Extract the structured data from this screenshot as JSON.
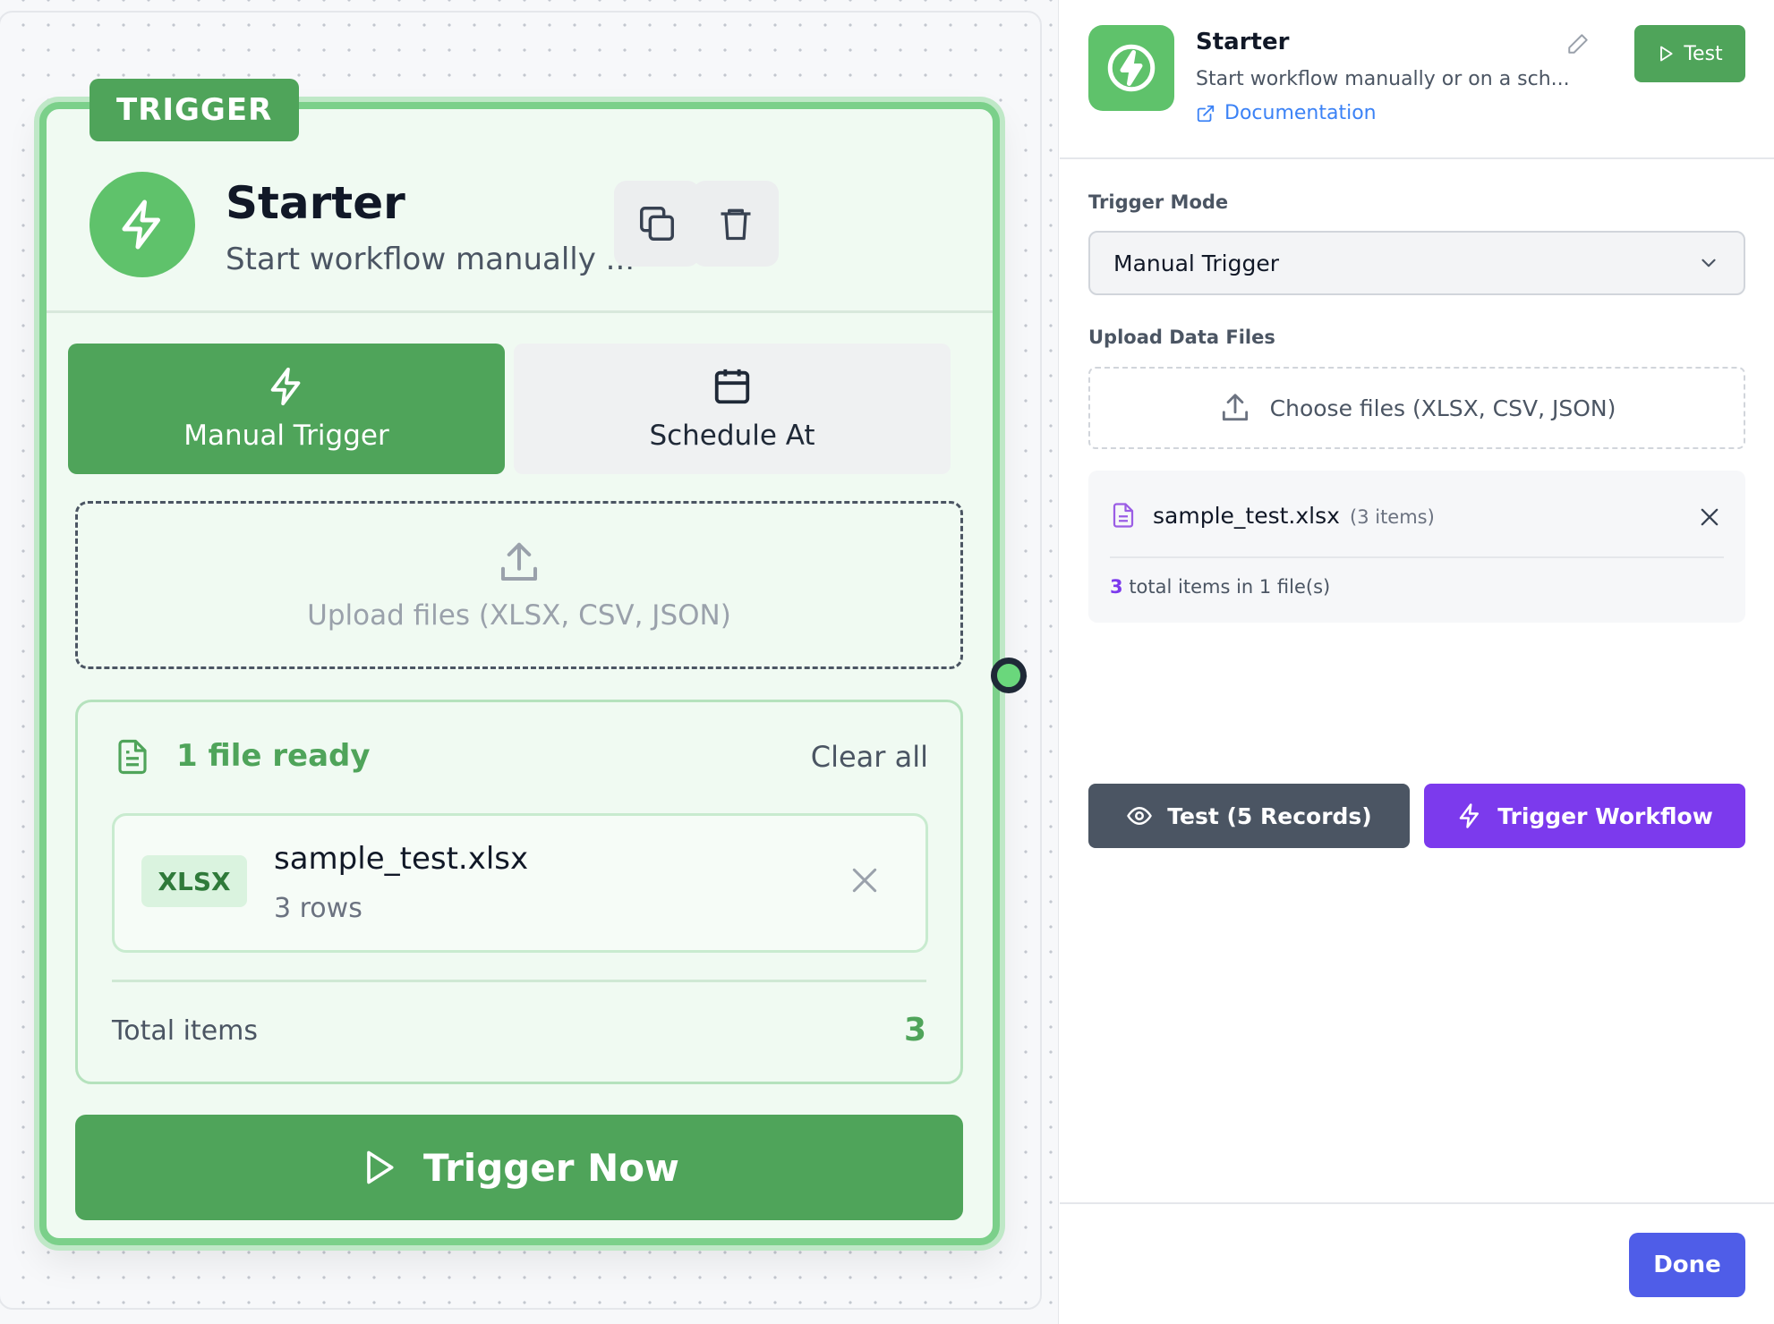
{
  "node": {
    "tag": "TRIGGER",
    "title": "Starter",
    "subtitle": "Start workflow manually ...",
    "icons": {
      "avatar": "lightning-icon",
      "copy": "copy-icon",
      "delete": "trash-icon"
    },
    "modes": [
      {
        "label": "Manual Trigger",
        "icon": "lightning-icon",
        "active": true
      },
      {
        "label": "Schedule At",
        "icon": "calendar-icon",
        "active": false
      }
    ],
    "upload_label": "Upload files (XLSX, CSV, JSON)",
    "ready": {
      "title": "1 file ready",
      "clear_label": "Clear all",
      "file": {
        "badge": "XLSX",
        "name": "sample_test.xlsx",
        "rows": "3 rows"
      },
      "total_label": "Total items",
      "total_value": "3"
    },
    "trigger_now_label": "Trigger Now"
  },
  "panel": {
    "title": "Starter",
    "subtitle": "Start workflow manually or on a sch...",
    "doc_label": "Documentation",
    "test_label": "Test",
    "trigger_mode_label": "Trigger Mode",
    "trigger_mode_value": "Manual Trigger",
    "upload_label": "Upload Data Files",
    "upload_button": "Choose files (XLSX, CSV, JSON)",
    "file": {
      "name": "sample_test.xlsx",
      "count": "(3 items)"
    },
    "total": {
      "count": "3",
      "text": "total items in 1 file(s)"
    },
    "test_records_label": "Test (5 Records)",
    "trigger_workflow_label": "Trigger Workflow",
    "done_label": "Done"
  },
  "colors": {
    "green": "#4fa45a",
    "green_light": "#5fc26b",
    "purple": "#7c3aed",
    "slate": "#4b5563",
    "blue": "#4f5de8",
    "link": "#3b82f6"
  }
}
